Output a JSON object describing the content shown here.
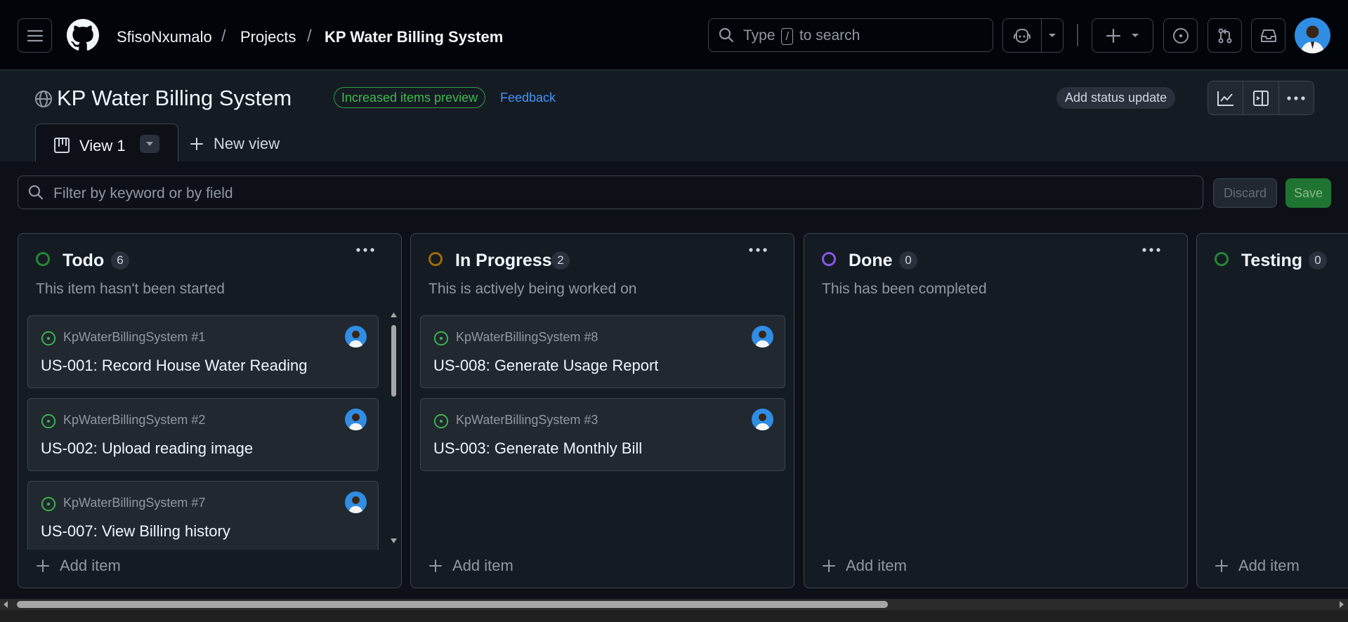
{
  "header": {
    "breadcrumbs": [
      "SfisoNxumalo",
      "Projects",
      "KP Water Billing System"
    ],
    "search": {
      "prefix": "Type",
      "key": "/",
      "suffix": "to search"
    }
  },
  "project": {
    "title": "KP Water Billing System",
    "preview_badge": "Increased items preview",
    "feedback": "Feedback",
    "status_update": "Add status update"
  },
  "tabs": {
    "active": "View 1",
    "new_view": "New view"
  },
  "filter": {
    "placeholder": "Filter by keyword or by field",
    "discard": "Discard",
    "save": "Save"
  },
  "columns": [
    {
      "name": "Todo",
      "count": "6",
      "description": "This item hasn't been started",
      "color": "#238636",
      "add_item": "Add item",
      "cards": [
        {
          "repo": "KpWaterBillingSystem #1",
          "title": "US-001: Record House Water Reading"
        },
        {
          "repo": "KpWaterBillingSystem #2",
          "title": "US-002: Upload reading image"
        },
        {
          "repo": "KpWaterBillingSystem #7",
          "title": "US-007: View Billing history"
        }
      ]
    },
    {
      "name": "In Progress",
      "count": "2",
      "description": "This is actively being worked on",
      "color": "#9e6a03",
      "add_item": "Add item",
      "cards": [
        {
          "repo": "KpWaterBillingSystem #8",
          "title": "US-008: Generate Usage Report"
        },
        {
          "repo": "KpWaterBillingSystem #3",
          "title": "US-003: Generate Monthly Bill"
        }
      ]
    },
    {
      "name": "Done",
      "count": "0",
      "description": "This has been completed",
      "color": "#8957e5",
      "add_item": "Add item",
      "cards": []
    },
    {
      "name": "Testing",
      "count": "0",
      "description": "",
      "color": "#238636",
      "add_item": "Add item",
      "cards": []
    }
  ],
  "colors": {
    "open_issue": "#3fb950",
    "accent_link": "#4493f8",
    "save_button": "#238636"
  }
}
